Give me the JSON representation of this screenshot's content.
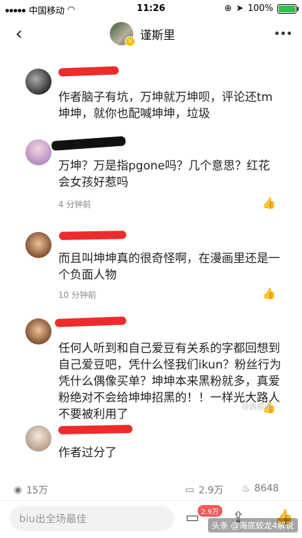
{
  "status_bar": {
    "carrier": "中国移动",
    "time": "11:26",
    "battery": "100%"
  },
  "header": {
    "title": "谨斯里"
  },
  "comments": [
    {
      "text": "作者脑子有坑，万坤就万坤呗，评论还tm坤坤，就你也配喊坤坤，垃圾",
      "time": ""
    },
    {
      "text": "万坤？万是指pgone吗？几个意思？红花会女孩好惹吗",
      "time": "4 分钟前"
    },
    {
      "text": "而且叫坤坤真的很奇怪啊，在漫画里还是一个负面人物",
      "time": "10 分钟前"
    },
    {
      "text": "任何人听到和自己爱豆有关系的字都回想到自己爱豆吧，凭什么怪我们ikun？粉丝行为凭什么偶像买单？坤坤本来黑粉就多，真爱粉绝对不会给坤坤招黑的！！一样光大路人不要被利用了",
      "time": ""
    },
    {
      "text": "作者过分了",
      "time": ""
    }
  ],
  "watermark": "@路痕德",
  "stats": {
    "views": "15万",
    "comments": "2.9万",
    "likes": "8648"
  },
  "bottom": {
    "input_placeholder": "biu出全场最佳",
    "comment_badge": "2.9万",
    "footer_watermark": "头条 @海底蛟龙4解说"
  },
  "colors": {
    "accent": "#f15a5a",
    "redaction": "#ee2b2b"
  },
  "icons": [
    "back-icon",
    "more-icon",
    "verified-icon",
    "thumb-up-icon",
    "eye-icon",
    "comment-icon",
    "share-icon",
    "like-icon"
  ]
}
